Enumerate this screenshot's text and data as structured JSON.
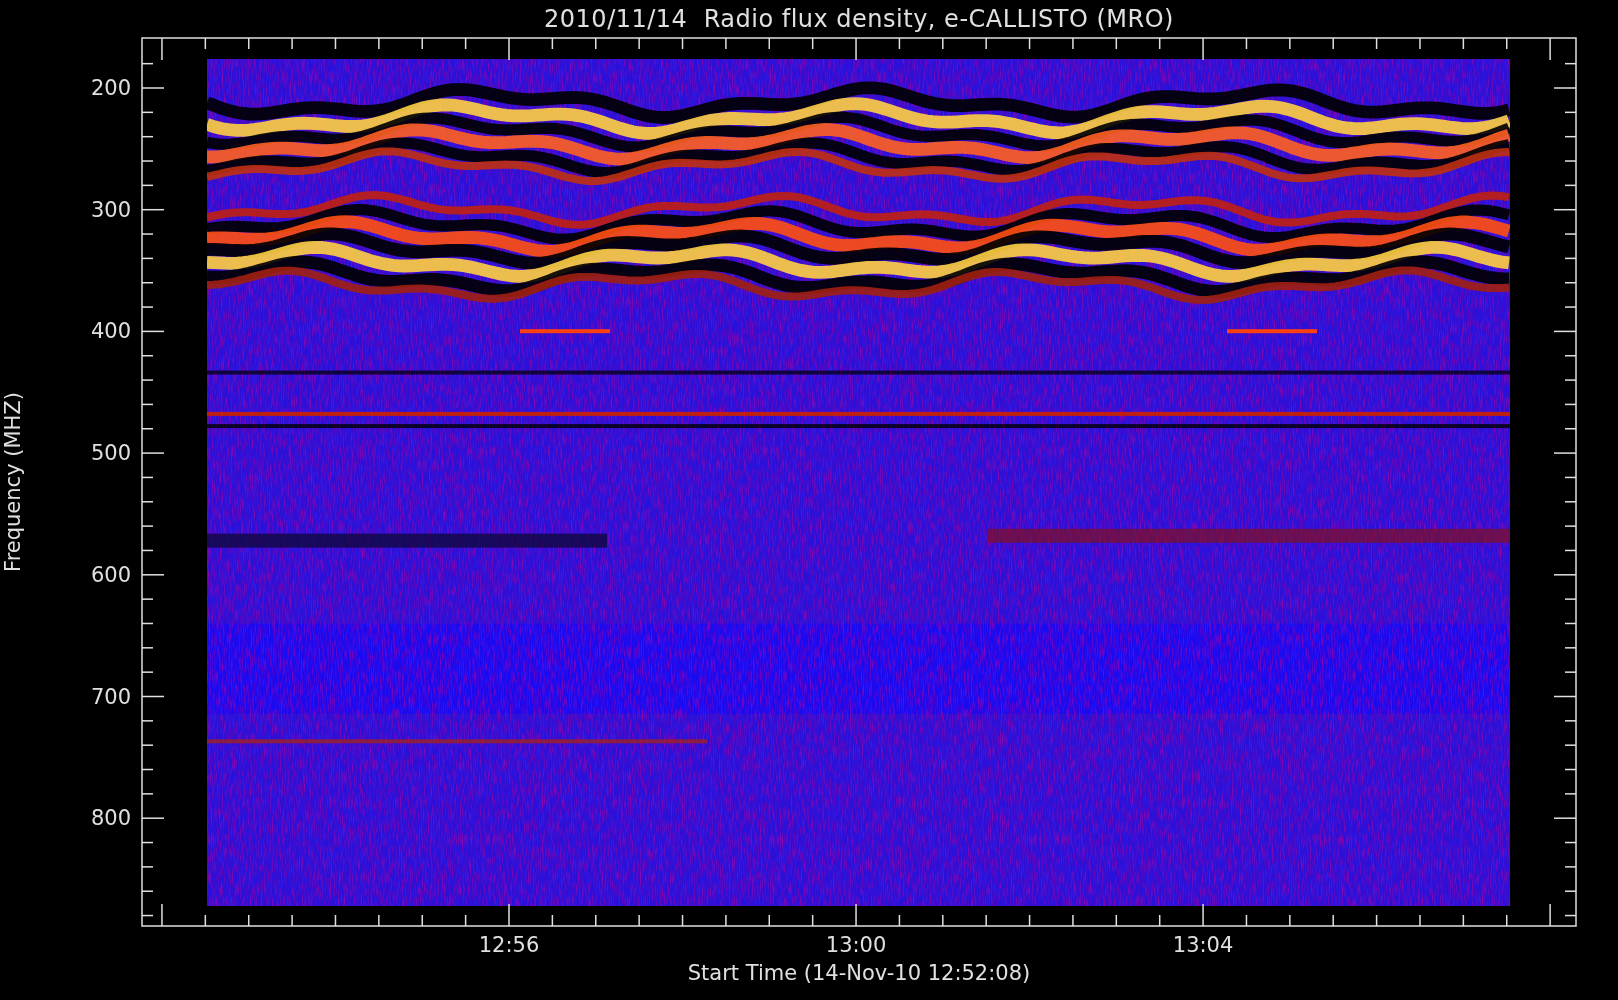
{
  "title": "2010/11/14  Radio flux density, e-CALLISTO (MRO)",
  "y_axis": {
    "label": "Frequency (MHZ)",
    "ticks": [
      "200",
      "300",
      "400",
      "500",
      "600",
      "700",
      "800"
    ]
  },
  "x_axis": {
    "label": "Start Time (14-Nov-10 12:52:08)",
    "ticks": [
      "12:56",
      "13:00",
      "13:04"
    ]
  }
}
